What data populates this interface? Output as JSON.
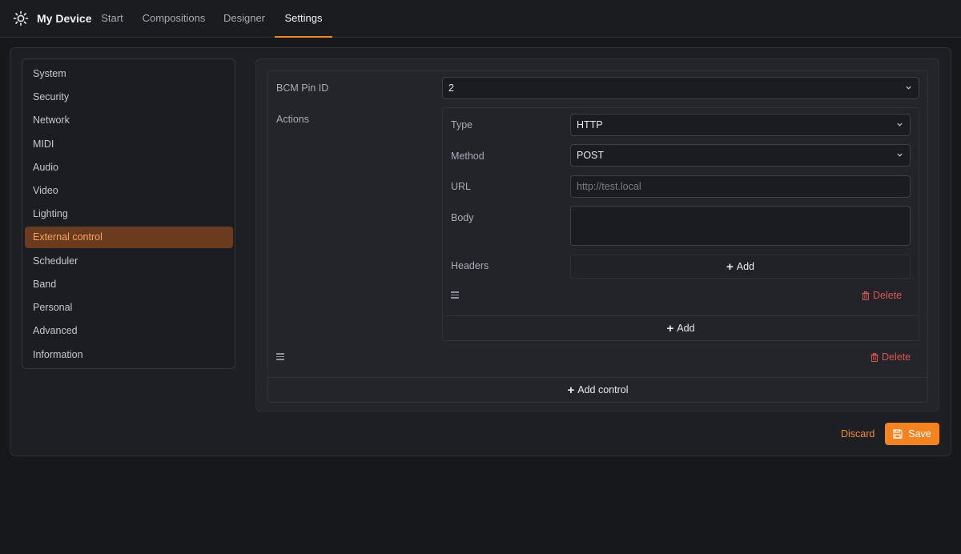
{
  "app": {
    "brand_name": "My Device",
    "brand_icon": "sun-icon"
  },
  "nav": {
    "tabs": [
      {
        "label": "Start"
      },
      {
        "label": "Compositions"
      },
      {
        "label": "Designer"
      },
      {
        "label": "Settings",
        "active": true
      }
    ]
  },
  "sidebar": {
    "items": [
      {
        "label": "System"
      },
      {
        "label": "Security"
      },
      {
        "label": "Network"
      },
      {
        "label": "MIDI"
      },
      {
        "label": "Audio"
      },
      {
        "label": "Video"
      },
      {
        "label": "Lighting"
      },
      {
        "label": "External control",
        "active": true
      },
      {
        "label": "Scheduler"
      },
      {
        "label": "Band"
      },
      {
        "label": "Personal"
      },
      {
        "label": "Advanced"
      },
      {
        "label": "Information"
      }
    ]
  },
  "control": {
    "bcm_label": "BCM Pin ID",
    "bcm_value": "2",
    "actions_label": "Actions",
    "action": {
      "type_label": "Type",
      "type_value": "HTTP",
      "method_label": "Method",
      "method_value": "POST",
      "url_label": "URL",
      "url_placeholder": "http://test.local",
      "url_value": "",
      "body_label": "Body",
      "body_value": "",
      "headers_label": "Headers",
      "headers_add": "Add",
      "delete_label": "Delete"
    },
    "actions_add": "Add",
    "delete_label": "Delete",
    "add_control": "Add control"
  },
  "footer": {
    "discard": "Discard",
    "save": "Save"
  },
  "colors": {
    "accent": "#f5831f",
    "danger": "#d9574f",
    "active_bg": "#6a3b1f"
  }
}
